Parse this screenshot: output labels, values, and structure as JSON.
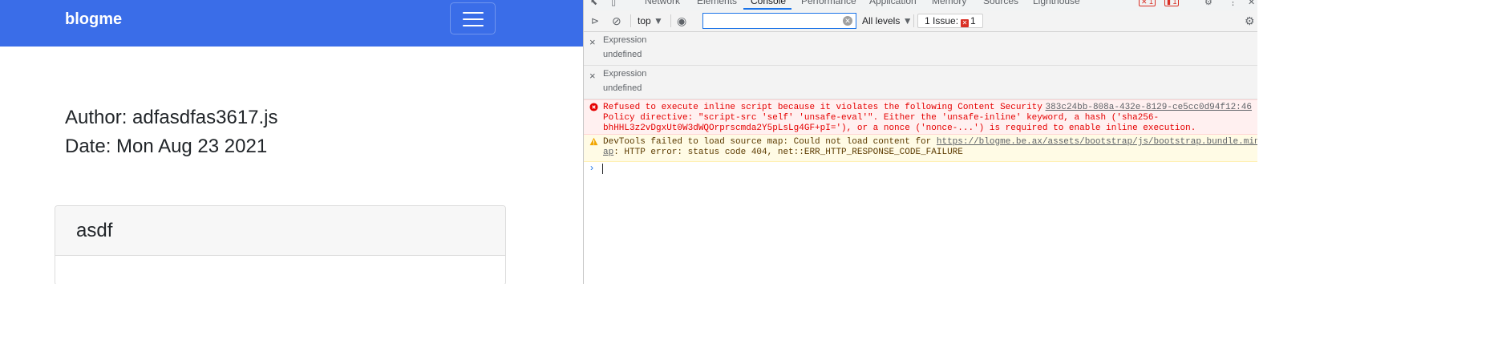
{
  "site": {
    "brand": "blogme",
    "author": "Author: adfasdfas3617.js",
    "date": "Date: Mon Aug 23 2021",
    "card_title": "asdf",
    "navbar_color": "#3a6de8"
  },
  "devtools": {
    "tabs": [
      "Network",
      "Elements",
      "Console",
      "Performance",
      "Application",
      "Memory",
      "Sources",
      "Lighthouse"
    ],
    "active_tab": "Console",
    "toolbar": {
      "context": "top",
      "filter_placeholder": "",
      "levels": "All levels",
      "issues_label": "1 Issue:",
      "issues_count": "1"
    },
    "expressions": [
      {
        "label": "Expression",
        "value": "undefined"
      },
      {
        "label": "Expression",
        "value": "undefined"
      }
    ],
    "error": {
      "line1": "Refused to execute inline script because it violates the following Content Security",
      "line2": "Policy directive: \"script-src 'self' 'unsafe-eval'\". Either the 'unsafe-inline' keyword, a hash ('sha256-",
      "line3": "bhHHL3z2vDgxUt0W3dWQOrprscmda2Y5pLsLg4GF+pI='), or a nonce ('nonce-...') is required to enable inline execution.",
      "source": "383c24bb-808a-432e-8129-ce5cc0d94f12:46",
      "color": "#e50000"
    },
    "warning": {
      "prefix": "DevTools failed to load source map: Could not load content for ",
      "url_part1": "https://blogme.be.ax/assets/bootstrap/js/bootstrap.bundle.min.js.m",
      "url_part2": "ap",
      "suffix": ": HTTP error: status code 404, net::ERR_HTTP_RESPONSE_CODE_FAILURE",
      "color": "#5c3b00"
    },
    "prompt_symbol": "›",
    "header_badges": [
      "1",
      "1"
    ]
  }
}
